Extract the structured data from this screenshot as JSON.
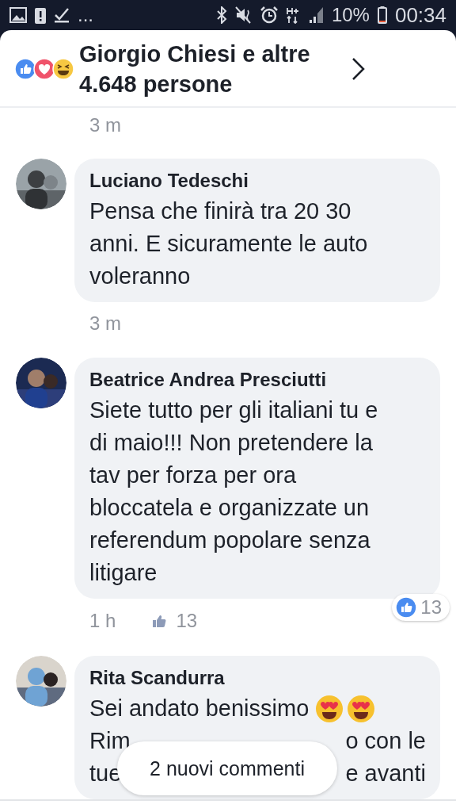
{
  "status_bar": {
    "more": "...",
    "battery": "10%",
    "time": "00:34"
  },
  "header": {
    "reactions": [
      {
        "kind": "like"
      },
      {
        "kind": "love"
      },
      {
        "kind": "haha"
      }
    ],
    "title": "Giorgio Chiesi e altre 4.648 persone"
  },
  "top_meta": {
    "time": "3 m"
  },
  "comments": [
    {
      "name": "Luciano Tedeschi",
      "lines": [
        "Pensa che finirà tra 20 30",
        "anni. E sicuramente le auto",
        "voleranno"
      ],
      "time": "3 m"
    },
    {
      "name": "Beatrice Andrea Presciutti",
      "lines": [
        "Siete tutto per gli italiani tu e",
        "di maio!!! Non pretendere la",
        "tav per forza per ora",
        "bloccatela e organizzate un",
        "referendum popolare senza",
        "litigare"
      ],
      "time": "1 h",
      "likes": "13",
      "reaction_count": "13"
    },
    {
      "name": "Rita Scandurra",
      "fragments": [
        {
          "left": "Sei andato benissimo",
          "emojis": [
            {
              "kind": "heart_eyes"
            },
            {
              "kind": "heart_eyes"
            }
          ]
        },
        {
          "left": "Rim",
          "right": "o con le"
        },
        {
          "left": "tue",
          "right": "e avanti"
        }
      ]
    }
  ],
  "toast": "2 nuovi commenti"
}
